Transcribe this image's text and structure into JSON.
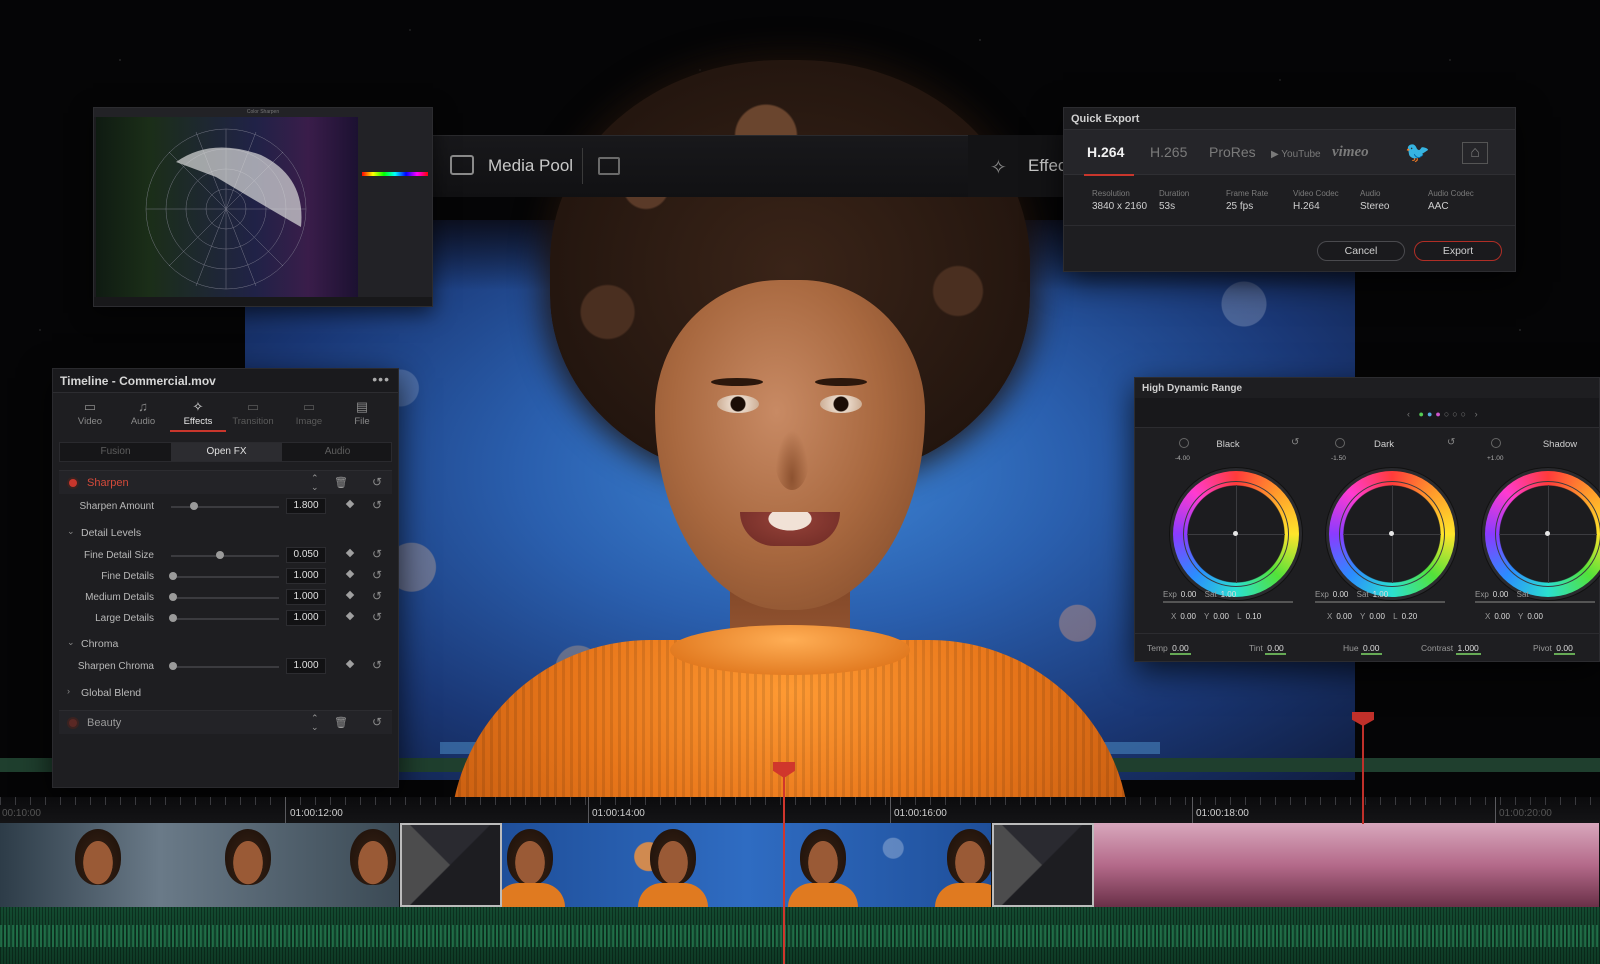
{
  "media_pool": {
    "label": "Media Pool",
    "effects_label": "Effec"
  },
  "scope": {
    "title": "Color Sharpen"
  },
  "timeline_panel": {
    "title": "Timeline - Commercial.mov",
    "more": "•••",
    "tabs": [
      {
        "label": "Video",
        "icon": "video-icon"
      },
      {
        "label": "Audio",
        "icon": "music-note-icon"
      },
      {
        "label": "Effects",
        "icon": "magic-wand-icon"
      },
      {
        "label": "Transition",
        "icon": "transition-icon"
      },
      {
        "label": "Image",
        "icon": "image-icon"
      },
      {
        "label": "File",
        "icon": "file-icon"
      }
    ],
    "segments": [
      "Fusion",
      "Open FX",
      "Audio"
    ],
    "effects": [
      {
        "name": "Sharpen",
        "active": true
      },
      {
        "name": "Beauty",
        "active": false
      }
    ],
    "params": {
      "sharpen_amount": {
        "label": "Sharpen Amount",
        "value": "1.800"
      },
      "fine_detail_size": {
        "label": "Fine Detail Size",
        "value": "0.050"
      },
      "fine_details": {
        "label": "Fine Details",
        "value": "1.000"
      },
      "medium_details": {
        "label": "Medium Details",
        "value": "1.000"
      },
      "large_details": {
        "label": "Large Details",
        "value": "1.000"
      },
      "sharpen_chroma": {
        "label": "Sharpen Chroma",
        "value": "1.000"
      }
    },
    "groups": {
      "detail_levels": "Detail Levels",
      "chroma": "Chroma",
      "global_blend": "Global Blend"
    }
  },
  "quick_export": {
    "title": "Quick Export",
    "formats": [
      "H.264",
      "H.265",
      "ProRes",
      "YouTube",
      "vimeo"
    ],
    "specs": [
      {
        "label": "Resolution",
        "value": "3840 x 2160"
      },
      {
        "label": "Duration",
        "value": "53s"
      },
      {
        "label": "Frame Rate",
        "value": "25 fps"
      },
      {
        "label": "Video Codec",
        "value": "H.264"
      },
      {
        "label": "Audio",
        "value": "Stereo"
      },
      {
        "label": "Audio Codec",
        "value": "AAC"
      }
    ],
    "cancel": "Cancel",
    "export": "Export"
  },
  "hdr": {
    "title": "High Dynamic Range",
    "wheels": [
      {
        "name": "Black",
        "level": "-4.00",
        "exp": "0.00",
        "sat": "1.00",
        "x": "0.00",
        "y": "0.00",
        "l": "0.10"
      },
      {
        "name": "Dark",
        "level": "-1.50",
        "exp": "0.00",
        "sat": "1.00",
        "x": "0.00",
        "y": "0.00",
        "l": "0.20"
      },
      {
        "name": "Shadow",
        "level": "+1.00",
        "exp": "0.00",
        "sat": "Sat",
        "x": "0.00",
        "y": "0.00",
        "l": ""
      }
    ],
    "labels": {
      "exp": "Exp",
      "sat": "Sat",
      "x": "X",
      "y": "Y",
      "l": "L"
    },
    "bottom": {
      "temp_label": "Temp",
      "temp": "0.00",
      "tint_label": "Tint",
      "tint": "0.00",
      "hue_label": "Hue",
      "hue": "0.00",
      "contrast_label": "Contrast",
      "contrast": "1.000",
      "pivot_label": "Pivot",
      "pivot": "0.00"
    }
  },
  "timeline": {
    "timecodes": [
      "00:10:00",
      "01:00:12:00",
      "01:00:14:00",
      "01:00:16:00",
      "01:00:18:00",
      "01:00:20:00"
    ]
  },
  "colors": {
    "accent": "#c9362c",
    "panel": "#1e1e21"
  }
}
